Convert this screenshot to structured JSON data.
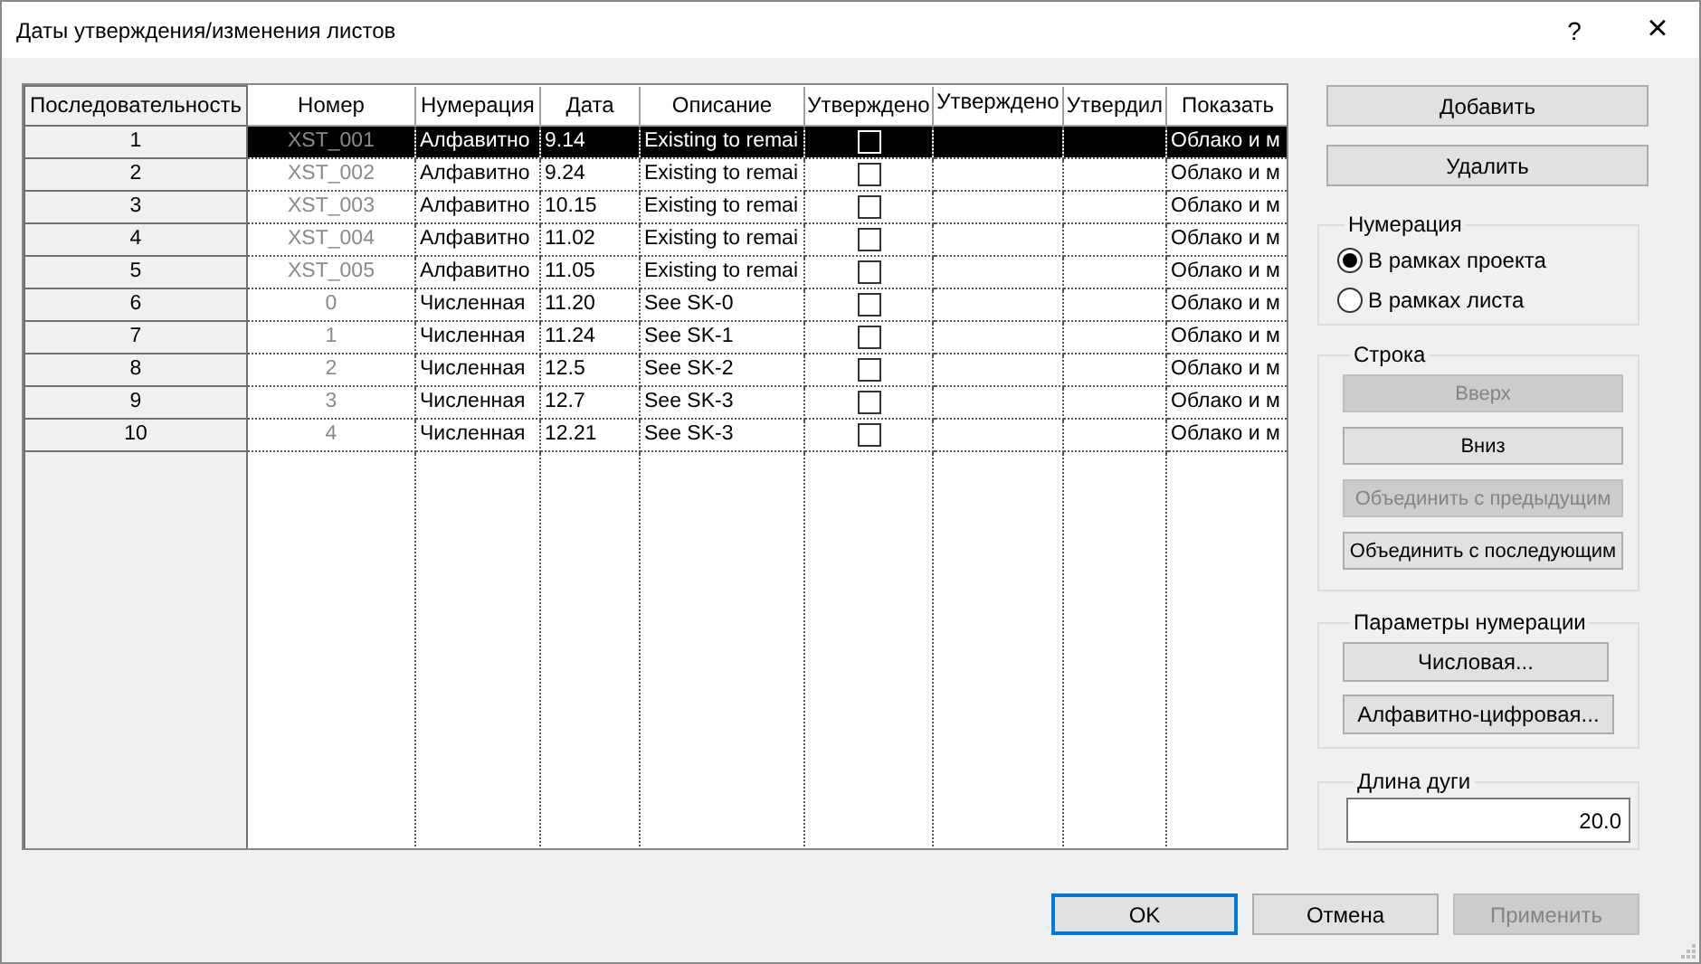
{
  "window": {
    "title": "Даты утверждения/изменения листов",
    "help": "?",
    "close": "×"
  },
  "table": {
    "columns": [
      "Последовательность",
      "Номер",
      "Нумерация",
      "Дата",
      "Описание",
      "Утверждено",
      "Утверждено",
      "Утвердил",
      "Показать"
    ],
    "rows": [
      {
        "sequence": "1",
        "number": "XST_001",
        "numbering": "Алфавитно",
        "date": "9.14",
        "description": "Existing to remai",
        "approved": false,
        "show": "Облако и м",
        "selected": true
      },
      {
        "sequence": "2",
        "number": "XST_002",
        "numbering": "Алфавитно",
        "date": "9.24",
        "description": "Existing to remai",
        "approved": false,
        "show": "Облако и м",
        "selected": false
      },
      {
        "sequence": "3",
        "number": "XST_003",
        "numbering": "Алфавитно",
        "date": "10.15",
        "description": "Existing to remai",
        "approved": false,
        "show": "Облако и м",
        "selected": false
      },
      {
        "sequence": "4",
        "number": "XST_004",
        "numbering": "Алфавитно",
        "date": "11.02",
        "description": "Existing to remai",
        "approved": false,
        "show": "Облако и м",
        "selected": false
      },
      {
        "sequence": "5",
        "number": "XST_005",
        "numbering": "Алфавитно",
        "date": "11.05",
        "description": "Existing to remai",
        "approved": false,
        "show": "Облако и м",
        "selected": false
      },
      {
        "sequence": "6",
        "number": "0",
        "numbering": "Численная",
        "date": "11.20",
        "description": "See SK-0",
        "approved": false,
        "show": "Облако и м",
        "selected": false
      },
      {
        "sequence": "7",
        "number": "1",
        "numbering": "Численная",
        "date": "11.24",
        "description": "See SK-1",
        "approved": false,
        "show": "Облако и м",
        "selected": false
      },
      {
        "sequence": "8",
        "number": "2",
        "numbering": "Численная",
        "date": "12.5",
        "description": "See SK-2",
        "approved": false,
        "show": "Облако и м",
        "selected": false
      },
      {
        "sequence": "9",
        "number": "3",
        "numbering": "Численная",
        "date": "12.7",
        "description": "See SK-3",
        "approved": false,
        "show": "Облако и м",
        "selected": false
      },
      {
        "sequence": "10",
        "number": "4",
        "numbering": "Численная",
        "date": "12.21",
        "description": "See SK-3",
        "approved": false,
        "show": "Облако и м",
        "selected": false
      }
    ]
  },
  "actions": [
    {
      "label": "Добавить",
      "disabled": false
    },
    {
      "label": "Удалить",
      "disabled": false
    }
  ],
  "numbering": {
    "title": "Нумерация",
    "options": [
      {
        "label": "В рамках проекта",
        "selected": true
      },
      {
        "label": "В рамках листа",
        "selected": false
      }
    ]
  },
  "row": {
    "title": "Строка",
    "buttons": [
      {
        "label": "Вверх",
        "disabled": true
      },
      {
        "label": "Вниз",
        "disabled": false
      },
      {
        "label": "Объединить с предыдущим",
        "disabled": true
      },
      {
        "label": "Объединить с последующим",
        "disabled": false
      }
    ]
  },
  "numbering_params": {
    "title": "Параметры нумерации",
    "buttons": [
      {
        "label": "Числовая...",
        "disabled": false
      },
      {
        "label": "Алфавитно-цифровая...",
        "disabled": false
      }
    ]
  },
  "arc_length": {
    "title": "Длина дуги",
    "value": "20.0"
  },
  "footer": [
    {
      "label": "OK",
      "disabled": false,
      "default": true
    },
    {
      "label": "Отмена",
      "disabled": false,
      "default": false
    },
    {
      "label": "Применить",
      "disabled": true,
      "default": false
    }
  ]
}
